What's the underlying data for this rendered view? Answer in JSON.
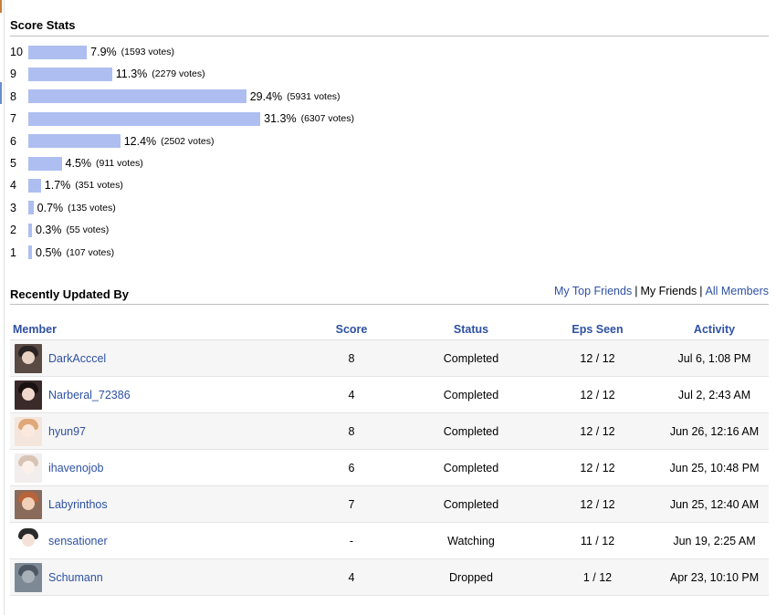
{
  "score_stats": {
    "title": "Score Stats",
    "bar_color": "#aebef0",
    "rows": [
      {
        "score": "10",
        "percent": "7.9%",
        "votes": "(1593 votes)",
        "value": 7.9
      },
      {
        "score": "9",
        "percent": "11.3%",
        "votes": "(2279 votes)",
        "value": 11.3
      },
      {
        "score": "8",
        "percent": "29.4%",
        "votes": "(5931 votes)",
        "value": 29.4
      },
      {
        "score": "7",
        "percent": "31.3%",
        "votes": "(6307 votes)",
        "value": 31.3
      },
      {
        "score": "6",
        "percent": "12.4%",
        "votes": "(2502 votes)",
        "value": 12.4
      },
      {
        "score": "5",
        "percent": "4.5%",
        "votes": "(911 votes)",
        "value": 4.5
      },
      {
        "score": "4",
        "percent": "1.7%",
        "votes": "(351 votes)",
        "value": 1.7
      },
      {
        "score": "3",
        "percent": "0.7%",
        "votes": "(135 votes)",
        "value": 0.7
      },
      {
        "score": "2",
        "percent": "0.3%",
        "votes": "(55 votes)",
        "value": 0.3
      },
      {
        "score": "1",
        "percent": "0.5%",
        "votes": "(107 votes)",
        "value": 0.5
      }
    ]
  },
  "recently_updated": {
    "title": "Recently Updated By",
    "links": {
      "my_top_friends": "My Top Friends",
      "separator": "|",
      "my_friends": "My Friends",
      "all_members": "All Members"
    },
    "columns": {
      "member": "Member",
      "score": "Score",
      "status": "Status",
      "eps_seen": "Eps Seen",
      "activity": "Activity"
    },
    "rows": [
      {
        "member": "DarkAcccel",
        "score": "8",
        "status": "Completed",
        "eps": "12 / 12",
        "activity": "Jul 6, 1:08 PM",
        "avatar_bg": "#5a4a44",
        "avatar_face": "#e8d2c4",
        "avatar_hair": "#2b2424"
      },
      {
        "member": "Narberal_72386",
        "score": "4",
        "status": "Completed",
        "eps": "12 / 12",
        "activity": "Jul 2, 2:43 AM",
        "avatar_bg": "#3a2a2a",
        "avatar_face": "#f0d8cc",
        "avatar_hair": "#1a1212"
      },
      {
        "member": "hyun97",
        "score": "8",
        "status": "Completed",
        "eps": "12 / 12",
        "activity": "Jun 26, 12:16 AM",
        "avatar_bg": "#f4e6dc",
        "avatar_face": "#fbe9dd",
        "avatar_hair": "#e0a878"
      },
      {
        "member": "ihavenojob",
        "score": "6",
        "status": "Completed",
        "eps": "12 / 12",
        "activity": "Jun 25, 10:48 PM",
        "avatar_bg": "#f2eeee",
        "avatar_face": "#fbf1ea",
        "avatar_hair": "#d8c4b4"
      },
      {
        "member": "Labyrinthos",
        "score": "7",
        "status": "Completed",
        "eps": "12 / 12",
        "activity": "Jun 25, 12:40 AM",
        "avatar_bg": "#8a6a5a",
        "avatar_face": "#f2d0b8",
        "avatar_hair": "#b8643a"
      },
      {
        "member": "sensationer",
        "score": "-",
        "status": "Watching",
        "eps": "11 / 12",
        "activity": "Jun 19, 2:25 AM",
        "avatar_bg": "#ffffff",
        "avatar_face": "#f4e2d8",
        "avatar_hair": "#2a2a2a"
      },
      {
        "member": "Schumann",
        "score": "4",
        "status": "Dropped",
        "eps": "1 / 12",
        "activity": "Apr 23, 10:10 PM",
        "avatar_bg": "#7d8a96",
        "avatar_face": "#a8b0b8",
        "avatar_hair": "#4e5864"
      }
    ]
  }
}
